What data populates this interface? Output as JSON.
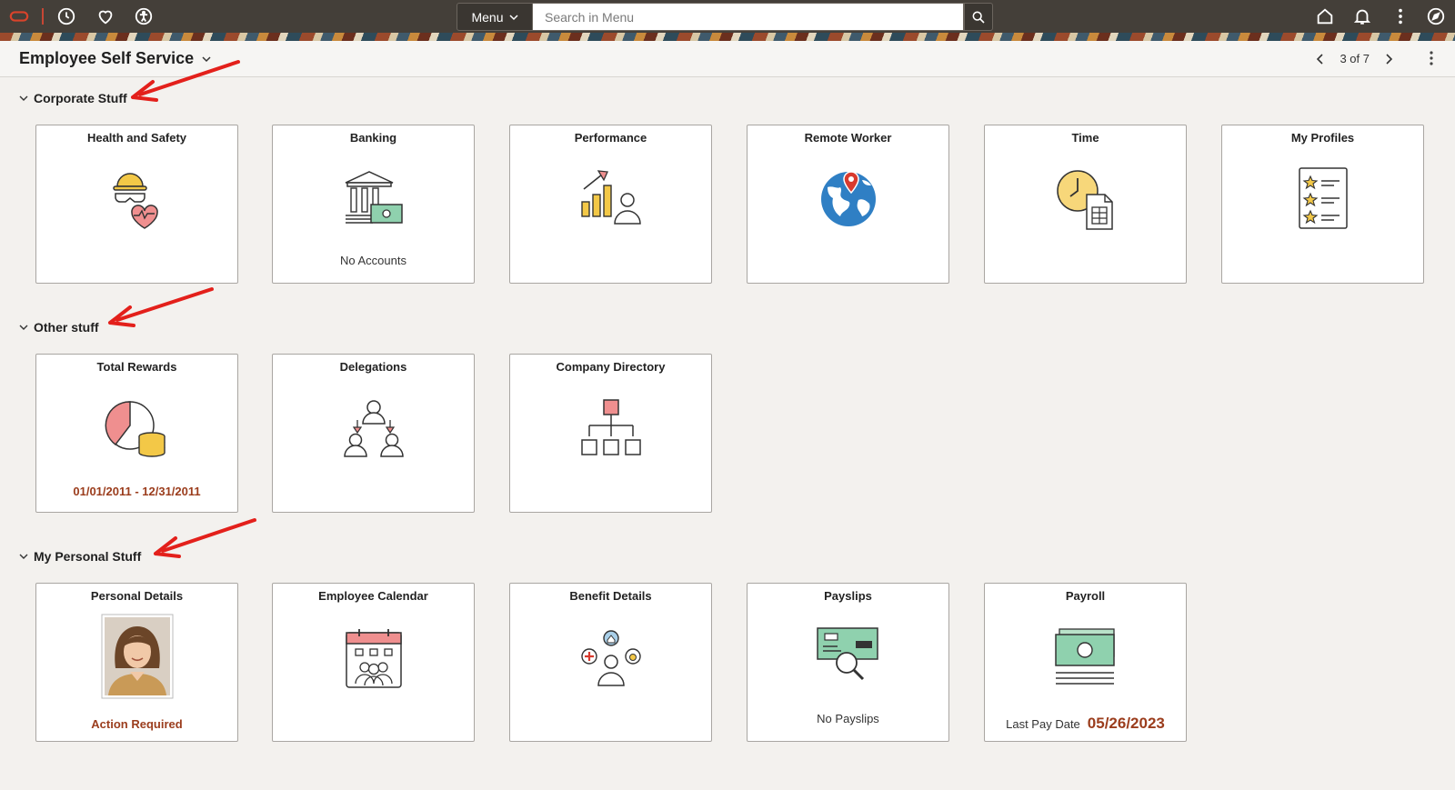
{
  "topbar": {
    "menu_label": "Menu",
    "search_placeholder": "Search in Menu"
  },
  "header": {
    "title": "Employee Self Service",
    "pager": "3 of 7"
  },
  "sections": {
    "corporate": {
      "title": "Corporate Stuff",
      "tiles": [
        {
          "title": "Health and Safety"
        },
        {
          "title": "Banking",
          "subtitle": "No Accounts"
        },
        {
          "title": "Performance"
        },
        {
          "title": "Remote Worker"
        },
        {
          "title": "Time"
        },
        {
          "title": "My Profiles"
        }
      ]
    },
    "other": {
      "title": "Other stuff",
      "tiles": [
        {
          "title": "Total Rewards",
          "subtitle": "01/01/2011 - 12/31/2011"
        },
        {
          "title": "Delegations"
        },
        {
          "title": "Company Directory"
        }
      ]
    },
    "personal": {
      "title": "My Personal Stuff",
      "tiles": [
        {
          "title": "Personal Details",
          "subtitle": "Action Required"
        },
        {
          "title": "Employee Calendar"
        },
        {
          "title": "Benefit Details"
        },
        {
          "title": "Payslips",
          "subtitle": "No Payslips"
        },
        {
          "title": "Payroll",
          "subtitle_label": "Last Pay Date",
          "subtitle_value": "05/26/2023"
        }
      ]
    }
  },
  "colors": {
    "banner": "#443f39",
    "accent_text": "#9b3d1d",
    "annotation_arrow": "#e3201b"
  },
  "icons": {
    "topbar": [
      "oracle-logo",
      "history-icon",
      "favorites-icon",
      "accessibility-icon",
      "home-icon",
      "bell-icon",
      "kebab-icon",
      "compass-icon"
    ]
  }
}
